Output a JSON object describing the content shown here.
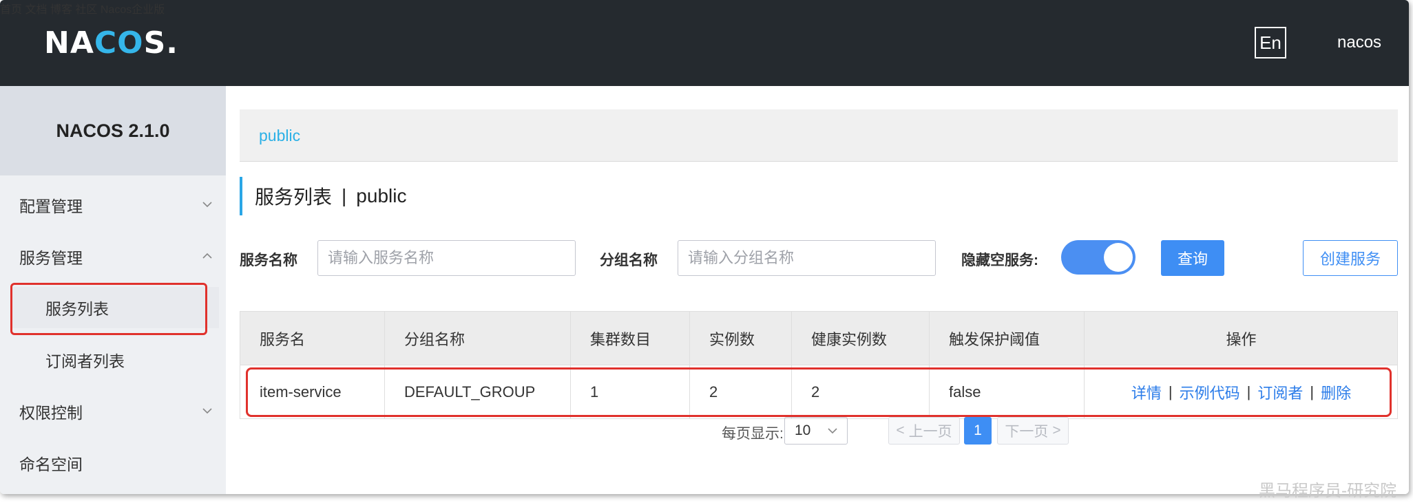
{
  "app": {
    "logo": {
      "pre": "NA",
      "mid": "CO",
      "post": "S."
    }
  },
  "header": {
    "nav": [
      "首页",
      "文档",
      "博客",
      "社区",
      "Nacos企业版"
    ],
    "lang": "En",
    "user": "nacos"
  },
  "sidebar": {
    "version": "NACOS 2.1.0",
    "items": [
      {
        "label": "配置管理"
      },
      {
        "label": "服务管理"
      },
      {
        "label": "服务列表"
      },
      {
        "label": "订阅者列表"
      },
      {
        "label": "权限控制"
      },
      {
        "label": "命名空间"
      }
    ]
  },
  "namespace": "public",
  "page": {
    "title": "服务列表",
    "sep": "|",
    "namespace": "public"
  },
  "filters": {
    "service_label": "服务名称",
    "service_placeholder": "请输入服务名称",
    "group_label": "分组名称",
    "group_placeholder": "请输入分组名称",
    "hide_empty_label": "隐藏空服务:",
    "hide_empty_on": true,
    "query_label": "查询",
    "create_label": "创建服务"
  },
  "table": {
    "headers": [
      "服务名",
      "分组名称",
      "集群数目",
      "实例数",
      "健康实例数",
      "触发保护阈值",
      "操作"
    ],
    "rows": [
      {
        "name": "item-service",
        "group": "DEFAULT_GROUP",
        "clusters": "1",
        "instances": "2",
        "healthy": "2",
        "threshold": "false"
      }
    ],
    "ops": [
      "详情",
      "示例代码",
      "订阅者",
      "删除"
    ],
    "op_sep": "|"
  },
  "pagination": {
    "page_size_label": "每页显示:",
    "page_size": "10",
    "prev": "上一页",
    "current": "1",
    "next": "下一页"
  },
  "watermark": "黑马程序员-研究院",
  "colors": {
    "header_bg": "#252a2f",
    "accent": "#3e8ef4",
    "highlight": "#e0312c",
    "link": "#2bb0e6"
  }
}
